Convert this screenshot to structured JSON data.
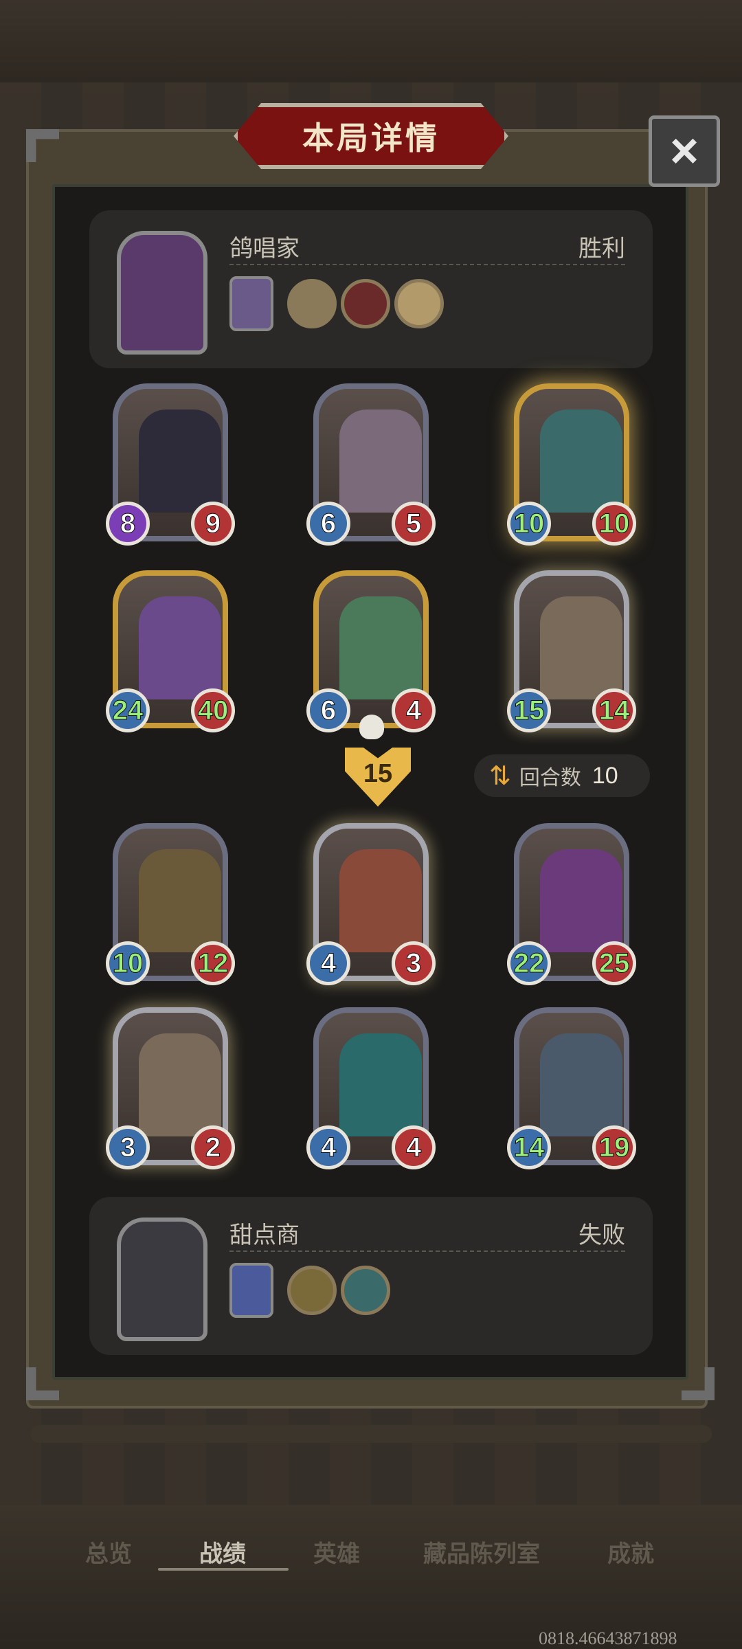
{
  "dialog": {
    "title": "本局详情",
    "close_label": "×"
  },
  "winner": {
    "name": "鸽唱家",
    "result": "胜利"
  },
  "loser": {
    "name": "甜点商",
    "result": "失败"
  },
  "winner_units": [
    {
      "atk": "8",
      "hp": "9"
    },
    {
      "atk": "6",
      "hp": "5"
    },
    {
      "atk": "10",
      "hp": "10"
    },
    {
      "atk": "24",
      "hp": "40"
    },
    {
      "atk": "6",
      "hp": "4"
    },
    {
      "atk": "15",
      "hp": "14"
    }
  ],
  "damage": "15",
  "round": {
    "label": "回合数",
    "value": "10"
  },
  "loser_units": [
    {
      "atk": "10",
      "hp": "12"
    },
    {
      "atk": "4",
      "hp": "3"
    },
    {
      "atk": "22",
      "hp": "25"
    },
    {
      "atk": "3",
      "hp": "2"
    },
    {
      "atk": "4",
      "hp": "4"
    },
    {
      "atk": "14",
      "hp": "19"
    }
  ],
  "nav": [
    "总览",
    "战绩",
    "英雄",
    "藏品陈列室",
    "成就"
  ],
  "uid": "0818.46643871898",
  "colors": {
    "accent_gold": "#e9b84a",
    "banner_red": "#7a1212",
    "stat_blue": "#3b6ea8",
    "stat_red": "#b33434",
    "buff_green": "#9df07b"
  }
}
